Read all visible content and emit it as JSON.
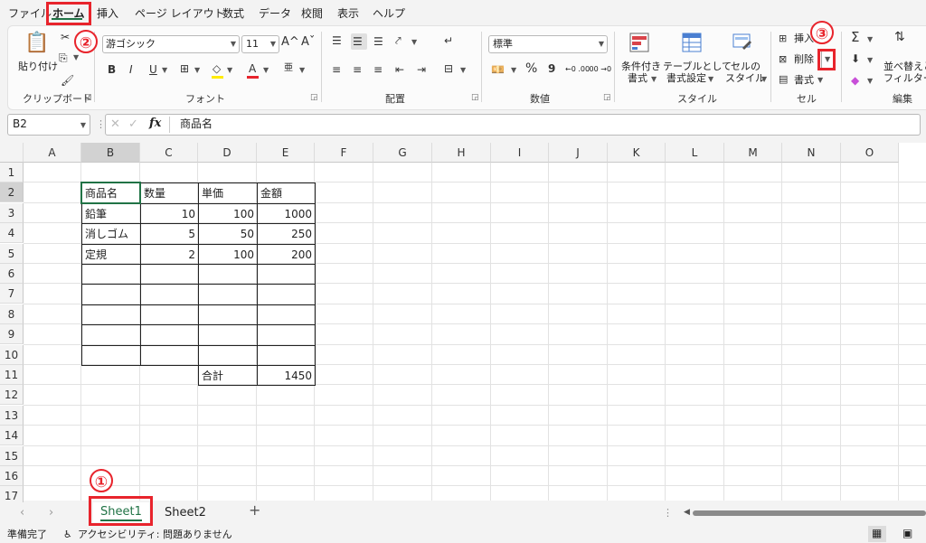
{
  "menu": {
    "items": [
      "ファイル",
      "ホーム",
      "挿入",
      "ページ レイアウト",
      "数式",
      "データ",
      "校閲",
      "表示",
      "ヘルプ"
    ]
  },
  "ribbon": {
    "clipboard": {
      "paste": "貼り付け",
      "label": "クリップボード"
    },
    "font": {
      "name": "游ゴシック",
      "size": "11",
      "bold": "B",
      "italic": "I",
      "underline": "U",
      "label": "フォント",
      "grow": "A",
      "shrink": "A"
    },
    "alignment": {
      "label": "配置"
    },
    "number": {
      "format": "標準",
      "label": "数値",
      "percent": "%",
      "comma": "9",
      "dec_inc": "←0 .00",
      "dec_dec": ".00 →0"
    },
    "styles": {
      "conditional": "条件付き\n書式",
      "conditional_1": "条件付き",
      "conditional_2": "書式",
      "table_1": "テーブルとして",
      "table_2": "書式設定",
      "cell_1": "セルの",
      "cell_2": "スタイル",
      "label": "スタイル"
    },
    "cells": {
      "insert": "挿入",
      "delete": "削除",
      "format": "書式",
      "label": "セル"
    },
    "editing": {
      "sort_1": "並べ替えと",
      "sort_2": "フィルター",
      "label": "編集",
      "sum": "Σ"
    }
  },
  "formula_bar": {
    "name_box": "B2",
    "fx": "fx",
    "content": "商品名"
  },
  "columns": [
    "A",
    "B",
    "C",
    "D",
    "E",
    "F",
    "G",
    "H",
    "I",
    "J",
    "K",
    "L",
    "M",
    "N",
    "O"
  ],
  "rows": [
    "1",
    "2",
    "3",
    "4",
    "5",
    "6",
    "7",
    "8",
    "9",
    "10",
    "11",
    "12",
    "13",
    "14",
    "15",
    "16",
    "17"
  ],
  "table": {
    "headers": [
      "商品名",
      "数量",
      "単価",
      "金額"
    ],
    "rows": [
      [
        "鉛筆",
        "10",
        "100",
        "1000"
      ],
      [
        "消しゴム",
        "5",
        "50",
        "250"
      ],
      [
        "定規",
        "2",
        "100",
        "200"
      ]
    ],
    "total_label": "合計",
    "total_value": "1450"
  },
  "sheets": {
    "tabs": [
      "Sheet1",
      "Sheet2"
    ],
    "add": "+"
  },
  "status": {
    "ready": "準備完了",
    "accessibility": "アクセシビリティ: 問題ありません"
  },
  "annotations": {
    "one": "①",
    "two": "②",
    "three": "③"
  },
  "colors": {
    "accent": "#217346",
    "callout": "#e8242c"
  }
}
